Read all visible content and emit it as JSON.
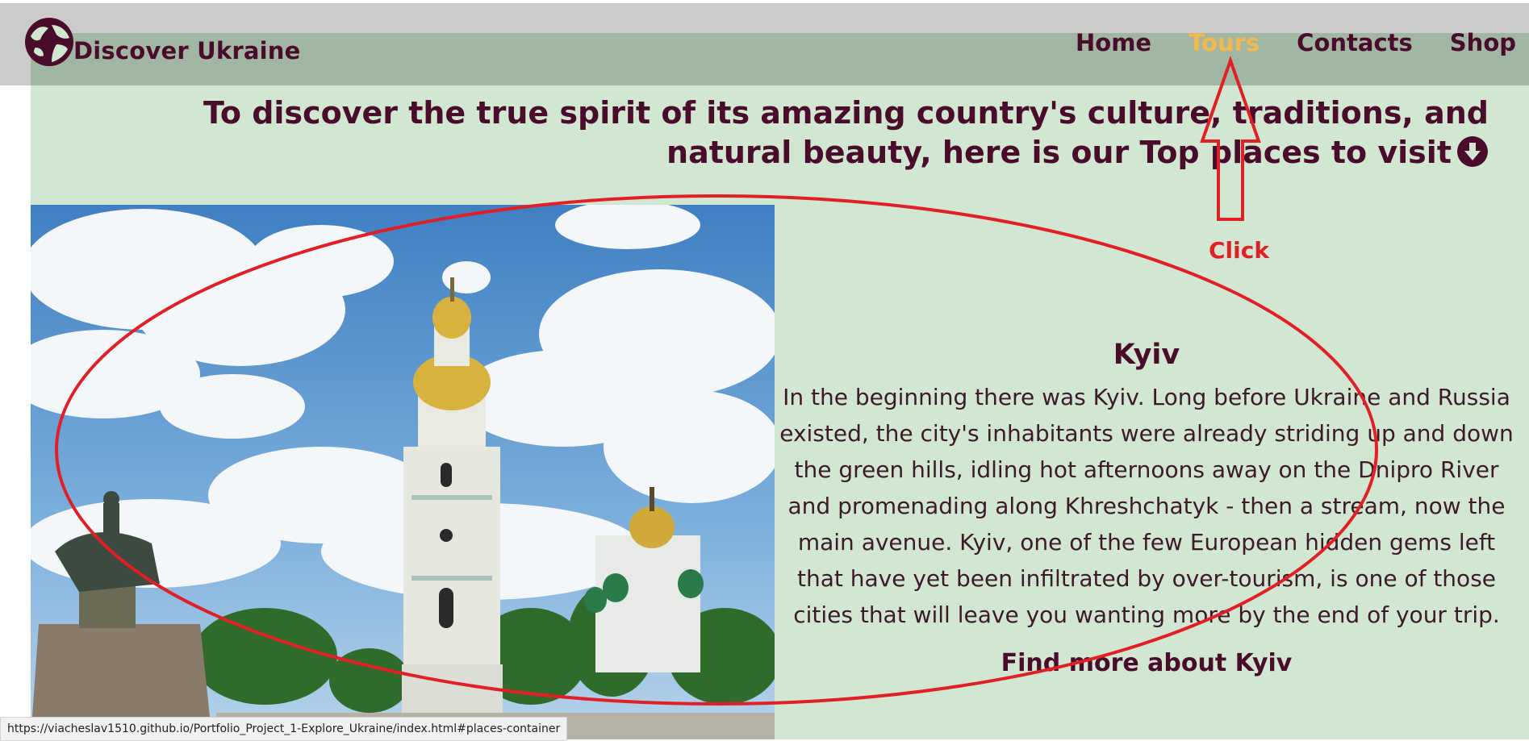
{
  "header": {
    "logo_text": "Discover Ukraine",
    "nav": [
      {
        "label": "Home",
        "active": false
      },
      {
        "label": "Tours",
        "active": true
      },
      {
        "label": "Contacts",
        "active": false
      },
      {
        "label": "Shop",
        "active": false
      }
    ]
  },
  "main": {
    "headline": "To discover the true spirit of its amazing country's culture, traditions, and natural beauty, here is our Top places to visit",
    "place": {
      "title": "Kyiv",
      "description": "In the beginning there was Kyiv. Long before Ukraine and Russia existed, the city's inhabitants were already striding up and down the green hills, idling hot afternoons away on the Dnipro River and promenading along Khreshchatyk - then a stream, now the main avenue. Kyiv, one of the few European hidden gems left that have yet been infiltrated by over-tourism, is one of those cities that will leave you wanting more by the end of your trip.",
      "link": "Find more about Kyiv"
    }
  },
  "annotation": {
    "label": "Click"
  },
  "status_bar": {
    "url": "https://viacheslav1510.github.io/Portfolio_Project_1-Explore_Ukraine/index.html#places-container"
  },
  "colors": {
    "brand": "#4a0c2b",
    "active_nav": "#f4b94b",
    "page_bg": "#d1e7d1",
    "header_bg": "#a2b7a3",
    "annotation_red": "#e11f26"
  },
  "icons": {
    "logo": "globe-icon",
    "headline": "arrow-down-circle-icon"
  }
}
